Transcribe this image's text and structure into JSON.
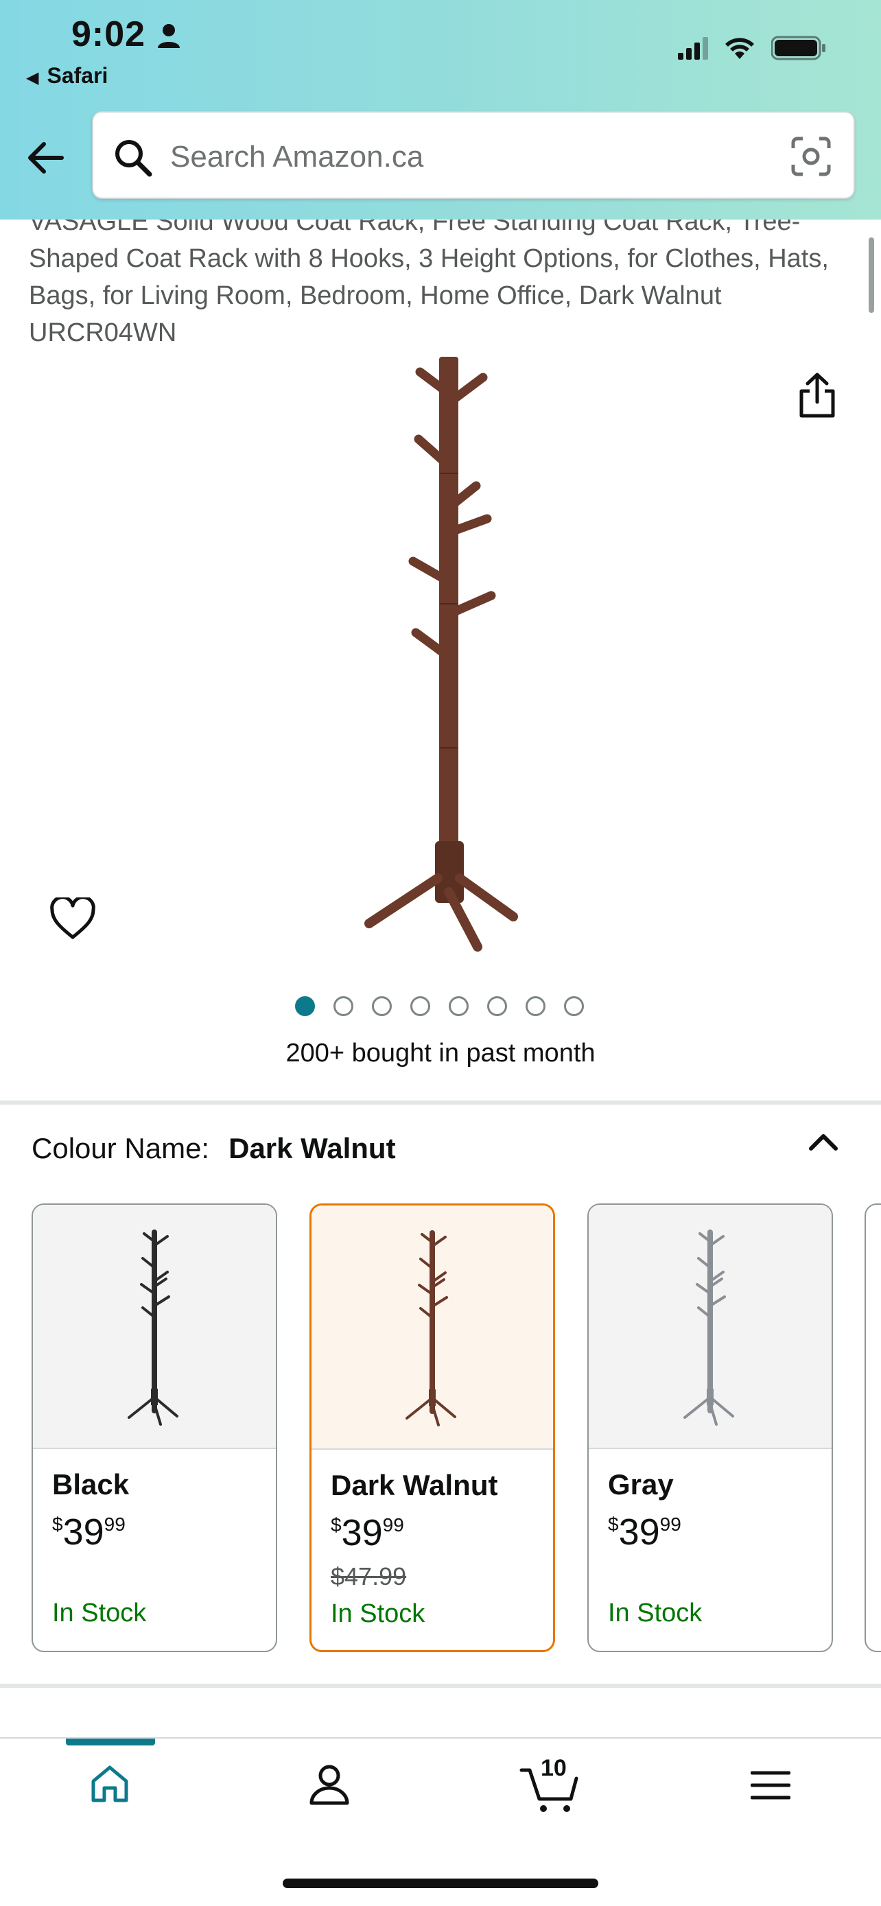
{
  "status_bar": {
    "time": "9:02",
    "back_app": "Safari"
  },
  "search": {
    "placeholder": "Search Amazon.ca"
  },
  "product": {
    "title": "VASAGLE Solid Wood Coat Rack, Free Standing Coat Rack, Tree-Shaped Coat Rack with 8 Hooks, 3 Height Options, for Clothes, Hats, Bags, for Living Room, Bedroom, Home Office, Dark Walnut URCR04WN",
    "image_count": 8,
    "active_image": 1,
    "bought_text": "200+ bought in past month"
  },
  "colour": {
    "label": "Colour Name:",
    "selected": "Dark Walnut",
    "options": [
      {
        "name": "Black",
        "currency": "$",
        "whole": "39",
        "fraction": "99",
        "list_price": "",
        "stock": "In Stock",
        "rack_color": "#2b2b2b"
      },
      {
        "name": "Dark Walnut",
        "currency": "$",
        "whole": "39",
        "fraction": "99",
        "list_price": "$47.99",
        "stock": "In Stock",
        "rack_color": "#6b3a2a"
      },
      {
        "name": "Gray",
        "currency": "$",
        "whole": "39",
        "fraction": "99",
        "list_price": "",
        "stock": "In Stock",
        "rack_color": "#8a8f96"
      }
    ]
  },
  "nav": {
    "cart_count": "10",
    "items": [
      "home-icon",
      "account-icon",
      "cart-icon",
      "menu-icon"
    ]
  },
  "colors": {
    "accent": "#0d7a8c",
    "in_stock": "#007600",
    "selected_border": "#e77600",
    "walnut": "#6b3a2a"
  }
}
